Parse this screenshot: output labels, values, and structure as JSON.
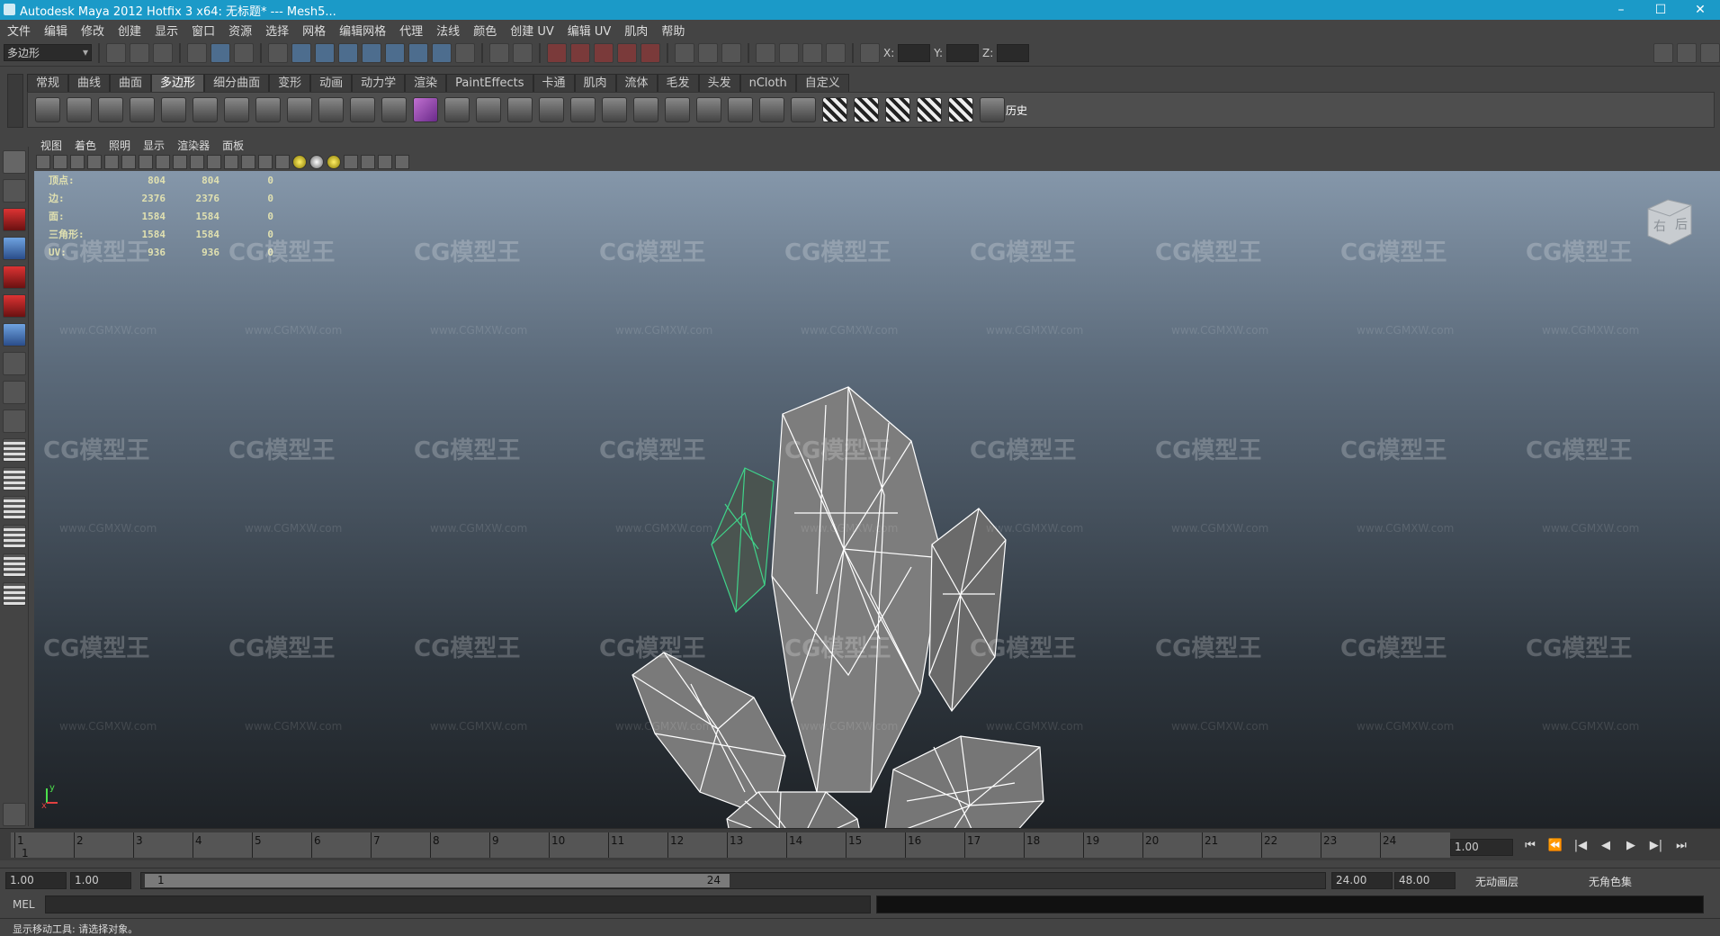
{
  "window": {
    "title": "Autodesk Maya 2012 Hotfix 3 x64: 无标题*   ---   Mesh5...",
    "minimize": "–",
    "maximize": "☐",
    "close": "✕"
  },
  "menubar": {
    "items": [
      "文件",
      "编辑",
      "修改",
      "创建",
      "显示",
      "窗口",
      "资源",
      "选择",
      "网格",
      "编辑网格",
      "代理",
      "法线",
      "颜色",
      "创建 UV",
      "编辑 UV",
      "肌肉",
      "帮助"
    ]
  },
  "statusline": {
    "mode": "多边形",
    "x_label": "X:",
    "y_label": "Y:",
    "z_label": "Z:"
  },
  "shelf": {
    "tabs": [
      "常规",
      "曲线",
      "曲面",
      "多边形",
      "细分曲面",
      "变形",
      "动画",
      "动力学",
      "渲染",
      "PaintEffects",
      "卡通",
      "肌肉",
      "流体",
      "毛发",
      "头发",
      "nCloth",
      "自定义"
    ],
    "active_tab": "多边形",
    "history_label": "历史"
  },
  "panel": {
    "menus": [
      "视图",
      "着色",
      "照明",
      "显示",
      "渲染器",
      "面板"
    ]
  },
  "hud": {
    "rows": [
      {
        "label": "顶点:",
        "a": "804",
        "b": "804",
        "c": "0"
      },
      {
        "label": "边:",
        "a": "2376",
        "b": "2376",
        "c": "0"
      },
      {
        "label": "面:",
        "a": "1584",
        "b": "1584",
        "c": "0"
      },
      {
        "label": "三角形:",
        "a": "1584",
        "b": "1584",
        "c": "0"
      },
      {
        "label": "UV:",
        "a": "936",
        "b": "936",
        "c": "0"
      }
    ]
  },
  "viewcube": {
    "right": "右",
    "back": "后"
  },
  "watermark": {
    "logo": "CG模型王",
    "url": "www.CGMXW.com",
    "corner_url": "www.CGMXW.com"
  },
  "axis": {
    "y": "y",
    "x": "x"
  },
  "timeslider": {
    "frames": [
      "1",
      "2",
      "3",
      "4",
      "5",
      "6",
      "7",
      "8",
      "9",
      "10",
      "11",
      "12",
      "13",
      "14",
      "15",
      "16",
      "17",
      "18",
      "19",
      "20",
      "21",
      "22",
      "23",
      "24"
    ],
    "current_marker": "1",
    "current_frame": "1.00"
  },
  "playback": {
    "buttons": [
      "⏮",
      "⏪",
      "|◀",
      "◀",
      "▶",
      "▶|",
      "⏭"
    ]
  },
  "range": {
    "start": "1.00",
    "start2": "1.00",
    "inner_start": "1",
    "inner_end": "24",
    "end": "24.00",
    "end2": "48.00",
    "anim_layer": "无动画层",
    "char_set": "无角色集"
  },
  "cmdline": {
    "label": "MEL"
  },
  "helpline": {
    "text": "显示移动工具: 请选择对象。"
  },
  "colors": {
    "titlebar": "#1b9ac8",
    "selection": "#3fd48a",
    "wire": "#ffffff"
  }
}
